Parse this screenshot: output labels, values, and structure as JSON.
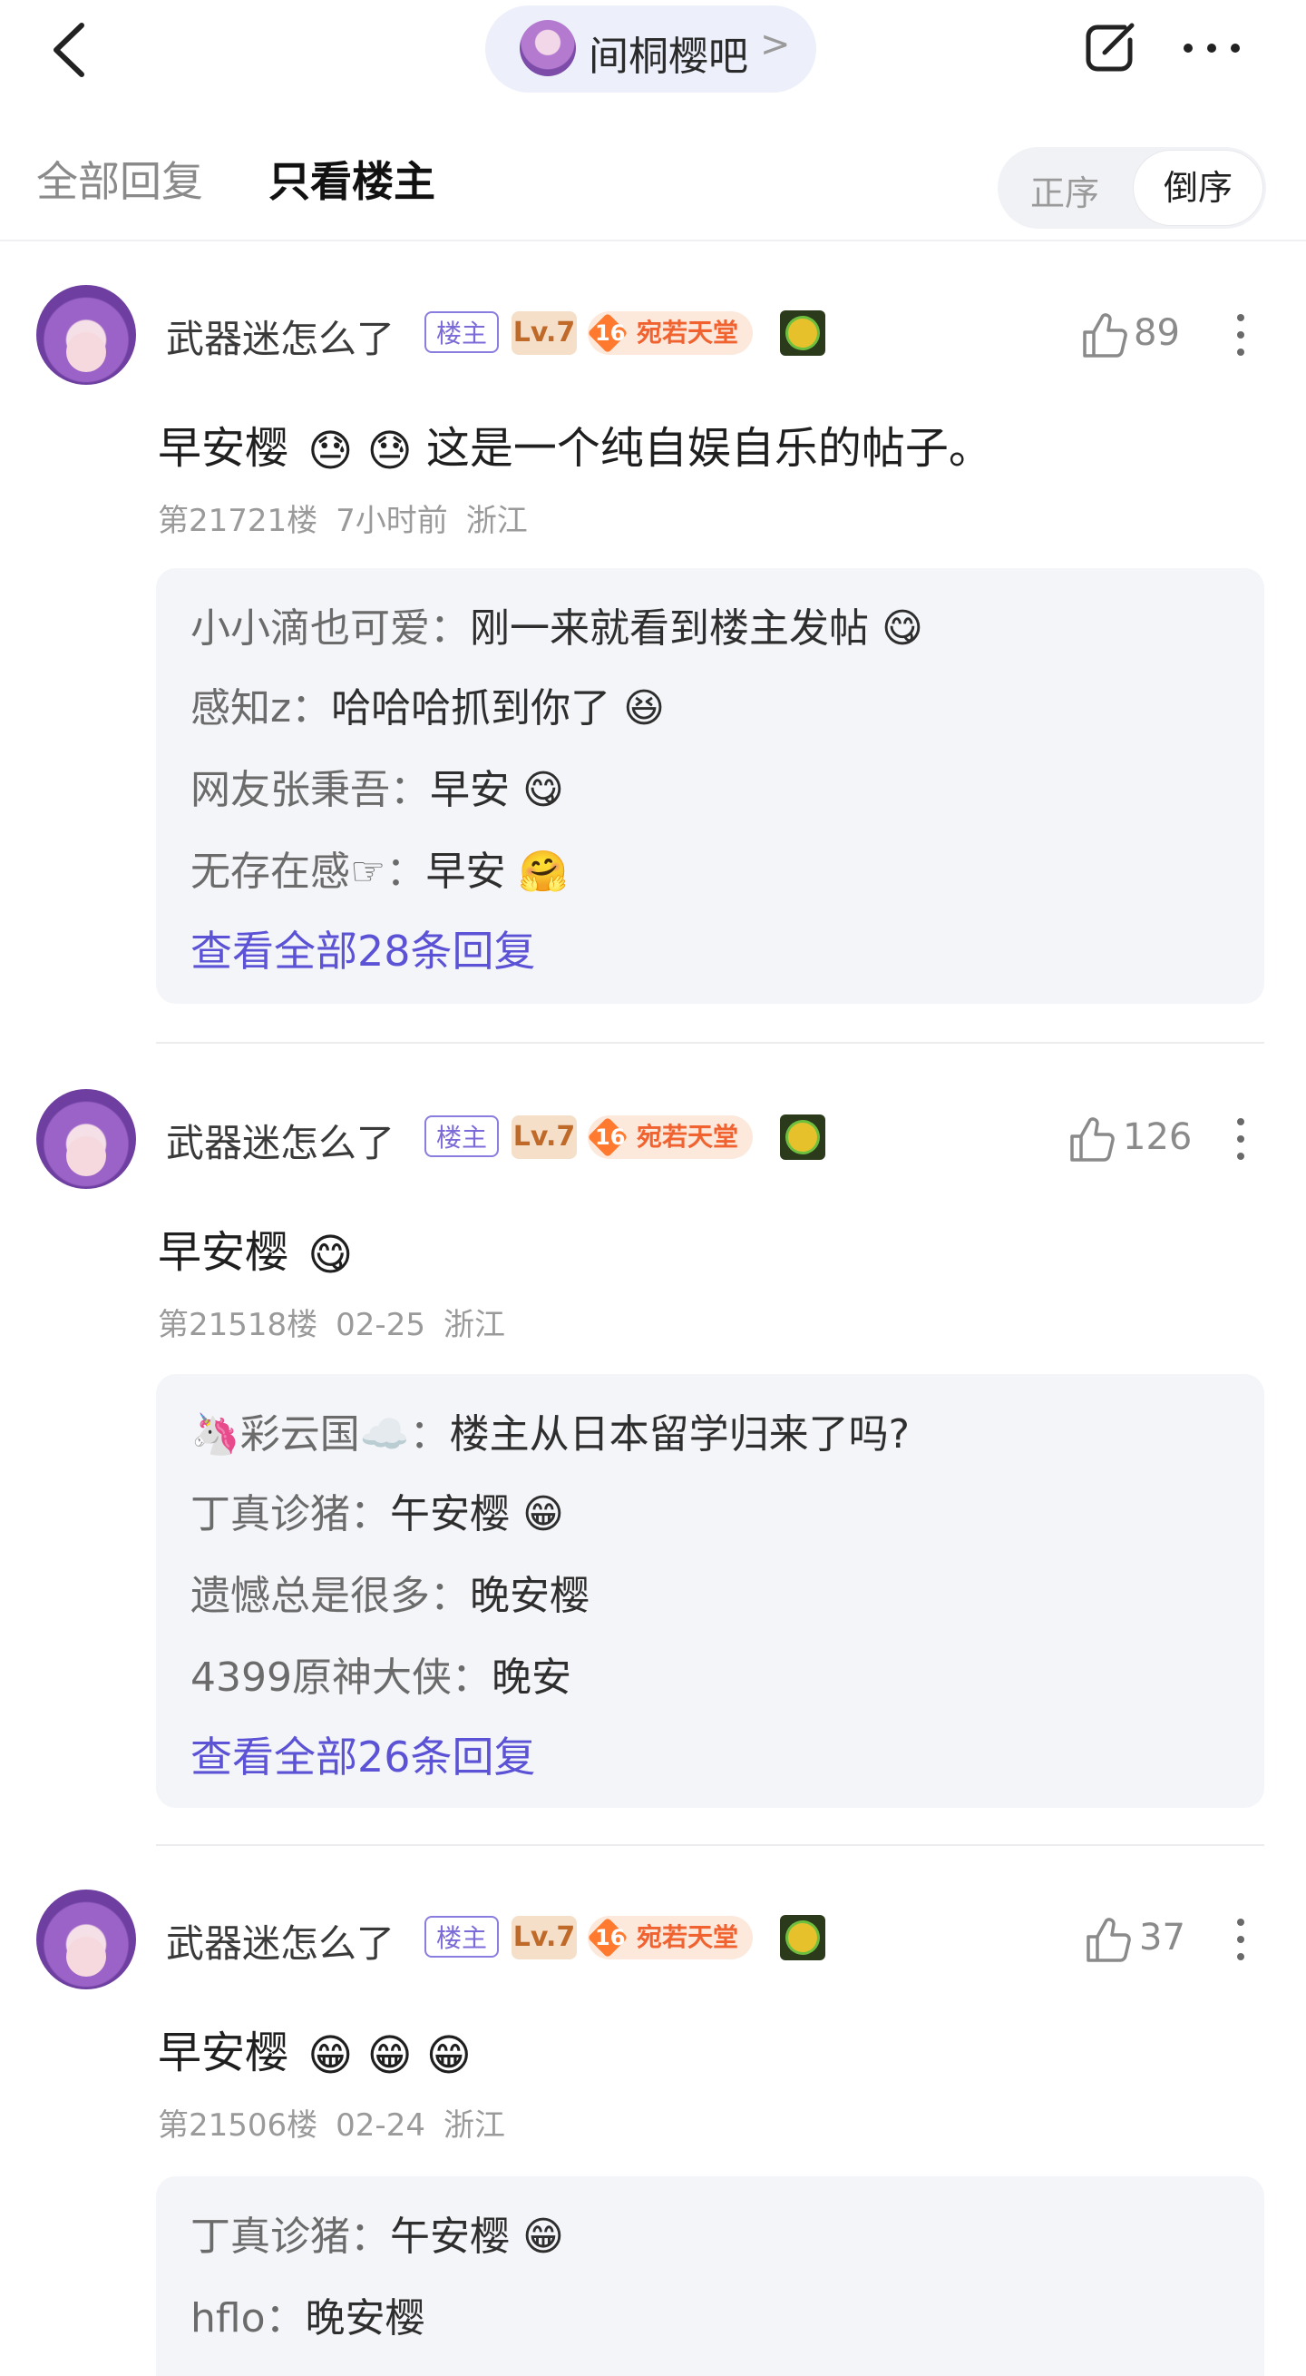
{
  "topbar": {
    "forum_name": "间桐樱吧",
    "forum_arrow": ">"
  },
  "tabs": {
    "all": "全部回复",
    "op_only": "只看楼主"
  },
  "sort": {
    "asc": "正序",
    "desc": "倒序"
  },
  "posts": [
    {
      "username": "武器迷怎么了",
      "badge_op": "楼主",
      "badge_level": "Lv.7",
      "badge_title_num": "16",
      "badge_title": "宛若天堂",
      "likes": "89",
      "content": "早安樱",
      "content_emojis": "😓 😓",
      "content_tail": "这是一个纯自娱自乐的帖子。",
      "floor": "第21721楼",
      "time": "7小时前",
      "location": "浙江",
      "replies": [
        {
          "name": "小小滴也可爱：",
          "text": "刚一来就看到楼主发帖",
          "emoji": "😋"
        },
        {
          "name": "感知z：",
          "text": "哈哈哈抓到你了",
          "emoji": "😆"
        },
        {
          "name": "网友张秉吾：",
          "text": "早安",
          "emoji": "😋"
        },
        {
          "name": "无存在感☞：",
          "text": "早安",
          "emoji": "🤗"
        }
      ],
      "view_all": "查看全部28条回复"
    },
    {
      "username": "武器迷怎么了",
      "badge_op": "楼主",
      "badge_level": "Lv.7",
      "badge_title_num": "16",
      "badge_title": "宛若天堂",
      "likes": "126",
      "content": "早安樱",
      "content_emojis": "😋",
      "content_tail": "",
      "floor": "第21518楼",
      "time": "02-25",
      "location": "浙江",
      "replies": [
        {
          "name": "🦄彩云国☁️：",
          "text": "楼主从日本留学归来了吗?",
          "emoji": ""
        },
        {
          "name": "丁真诊猪：",
          "text": "午安樱",
          "emoji": "😁"
        },
        {
          "name": "遗憾总是很多：",
          "text": "晚安樱",
          "emoji": ""
        },
        {
          "name": "4399原神大侠：",
          "text": "晚安",
          "emoji": ""
        }
      ],
      "view_all": "查看全部26条回复"
    },
    {
      "username": "武器迷怎么了",
      "badge_op": "楼主",
      "badge_level": "Lv.7",
      "badge_title_num": "16",
      "badge_title": "宛若天堂",
      "likes": "37",
      "content": "早安樱",
      "content_emojis": "😁 😁 😁",
      "content_tail": "",
      "floor": "第21506楼",
      "time": "02-24",
      "location": "浙江",
      "replies": [
        {
          "name": "丁真诊猪：",
          "text": "午安樱",
          "emoji": "😁"
        },
        {
          "name": "hflo：",
          "text": "晚安樱",
          "emoji": ""
        }
      ],
      "view_all": ""
    }
  ]
}
